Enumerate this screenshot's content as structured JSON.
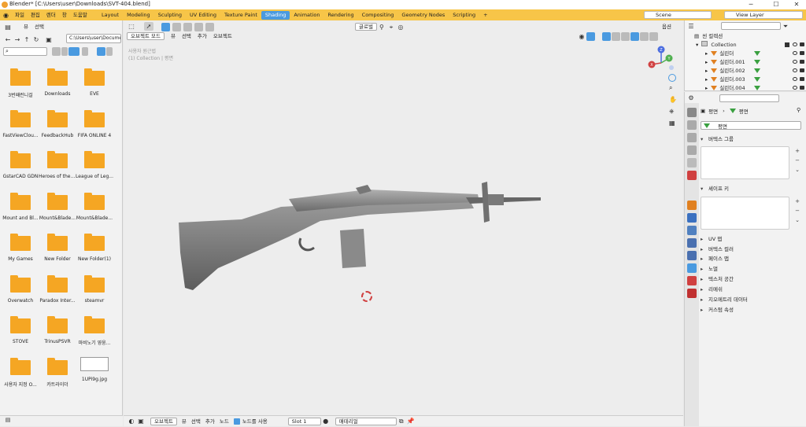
{
  "titlebar": {
    "title": "Blender* [C:\\Users\\user\\Downloads\\SVT-404.blend]",
    "minimize": "─",
    "maximize": "☐",
    "close": "✕"
  },
  "menus": [
    "파일",
    "편집",
    "렌더",
    "창",
    "도움말"
  ],
  "workspaces": [
    "Layout",
    "Modeling",
    "Sculpting",
    "UV Editing",
    "Texture Paint",
    "Shading",
    "Animation",
    "Rendering",
    "Compositing",
    "Geometry Nodes",
    "Scripting",
    "+"
  ],
  "active_workspace": "Shading",
  "scene": {
    "label": "Scene",
    "view_layer": "View Layer"
  },
  "filebrowser": {
    "menu": [
      "뷰",
      "선택"
    ],
    "path": "C:\\Users\\user\\Docume...",
    "items": [
      "3번째런니걸",
      "Downloads",
      "EVE",
      "FastViewClou...",
      "FeedbackHub",
      "FIFA ONLINE 4",
      "GstarCAD GDN",
      "Heroes of the ...",
      "League of Leg...",
      "Mount and Bl...",
      "Mount&Blade...",
      "Mount&Blade...",
      "My Games",
      "New Folder",
      "New Folder(1)",
      "Overwatch",
      "Paradox Inter...",
      "steamvr",
      "STOVE",
      "TrinusPSVR",
      "마비노기 영웅...",
      "사용자 지정 O...",
      "카트라이더",
      "1UPi9g.jpg"
    ]
  },
  "viewport": {
    "mode": "오브젝트 모드",
    "menu": [
      "뷰",
      "선택",
      "추가",
      "오브젝트"
    ],
    "transform": "글로벌",
    "options": "옵션",
    "overlay_line1": "사용자 원근법",
    "overlay_line2": "(1) Collection | 평면",
    "gizmo": {
      "x": "X",
      "y": "Y",
      "z": "Z"
    }
  },
  "statusbar": {
    "object": "오브젝트",
    "menu": [
      "뷰",
      "선택",
      "추가",
      "노드"
    ],
    "use_nodes": "노드를 사용",
    "slot": "Slot 1",
    "material": "매테리얼"
  },
  "outliner": {
    "title": "씬 컬렉션",
    "collection": "Collection",
    "objects": [
      "실린더",
      "실린더.001",
      "실린더.002",
      "실린더.003",
      "실린더.004"
    ]
  },
  "properties": {
    "breadcrumb_obj": "평면",
    "breadcrumb_mesh": "평면",
    "mesh_name": "평면",
    "sections": {
      "vertex_groups": "버텍스 그룹",
      "shape_keys": "셰이프 키",
      "uv_maps": "UV 맵",
      "vertex_colors": "버텍스 컬러",
      "face_maps": "페이스 맵",
      "normals": "노멀",
      "texture_space": "텍스처 공간",
      "remesh": "리메쉬",
      "geometry_data": "지오메트리 데이터",
      "custom_props": "커스텀 속성"
    }
  },
  "colors": {
    "accent": "#4a9ae0",
    "header": "#f7c548",
    "folder": "#f5a623"
  }
}
